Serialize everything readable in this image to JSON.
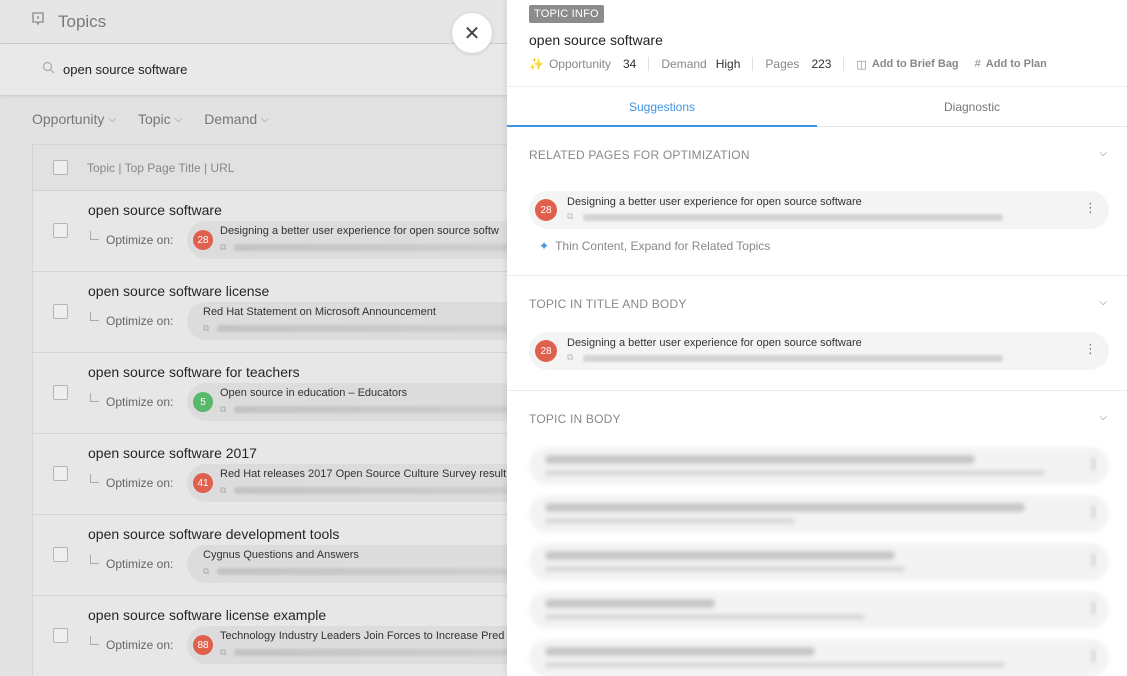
{
  "left": {
    "header_title": "Topics",
    "search_value": "open source software",
    "filters": [
      "Opportunity",
      "Topic",
      "Demand"
    ],
    "table_header": "Topic | Top Page Title | URL",
    "optimize_label": "Optimize on:",
    "rows": [
      {
        "topic": "open source software",
        "score": "28",
        "score_color": "#e0604e",
        "page_title": "Designing a better user experience for open source softw"
      },
      {
        "topic": "open source software license",
        "score": "",
        "score_color": "",
        "page_title": "Red Hat Statement on Microsoft Announcement"
      },
      {
        "topic": "open source software for teachers",
        "score": "5",
        "score_color": "#58b86b",
        "page_title": "Open source in education – Educators"
      },
      {
        "topic": "open source software 2017",
        "score": "41",
        "score_color": "#e0604e",
        "page_title": "Red Hat releases 2017 Open Source Culture Survey result"
      },
      {
        "topic": "open source software development tools",
        "score": "",
        "score_color": "",
        "page_title": "Cygnus Questions and Answers"
      },
      {
        "topic": "open source software license example",
        "score": "88",
        "score_color": "#e0604e",
        "page_title": "Technology Industry Leaders Join Forces to Increase Pred"
      }
    ]
  },
  "close_icon": "close-icon",
  "right": {
    "badge": "TOPIC INFO",
    "title": "open source software",
    "stats": {
      "opportunity_label": "Opportunity",
      "opportunity_value": "34",
      "demand_label": "Demand",
      "demand_value": "High",
      "pages_label": "Pages",
      "pages_value": "223"
    },
    "actions": {
      "brief_bag": "Add to Brief Bag",
      "plan": "Add to Plan"
    },
    "tabs": {
      "suggestions": "Suggestions",
      "diagnostic": "Diagnostic"
    },
    "sections": {
      "related": {
        "heading": "RELATED PAGES FOR OPTIMIZATION",
        "card_score": "28",
        "card_title": "Designing a better user experience for open source software",
        "hint": "Thin Content, Expand for Related Topics"
      },
      "title_body": {
        "heading": "TOPIC IN TITLE AND BODY",
        "card_score": "28",
        "card_title": "Designing a better user experience for open source software"
      },
      "body": {
        "heading": "TOPIC IN BODY"
      }
    },
    "accent_color": "#3f94e0"
  }
}
